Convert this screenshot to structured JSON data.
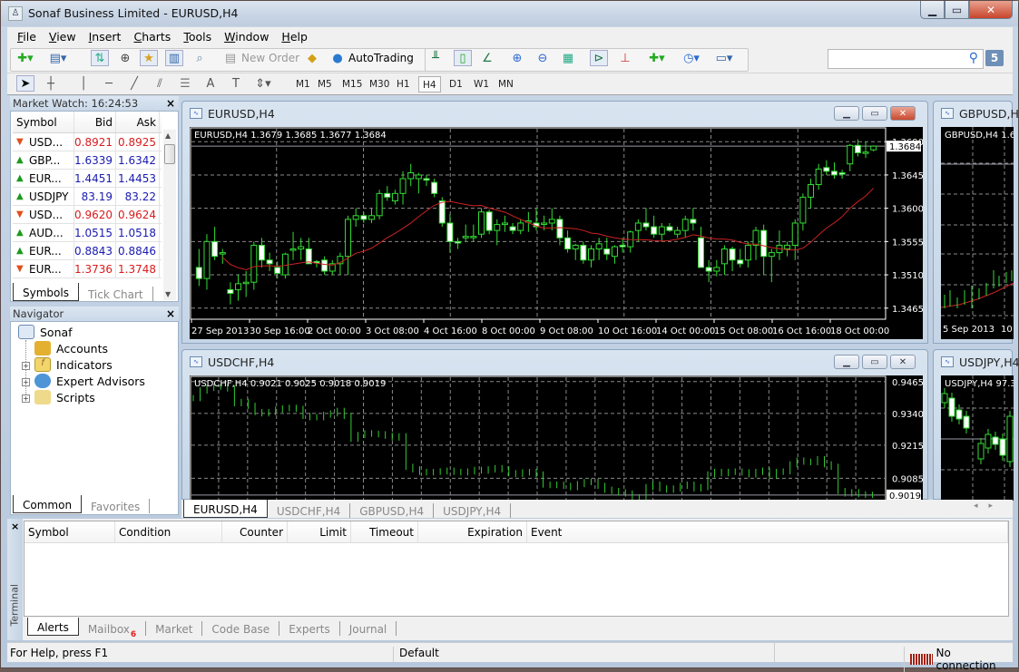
{
  "window": {
    "title": "Sonaf Business Limited - EURUSD,H4"
  },
  "menu": [
    "File",
    "View",
    "Insert",
    "Charts",
    "Tools",
    "Window",
    "Help"
  ],
  "toolbar": {
    "new_order_label": "New Order",
    "autotrading_label": "AutoTrading",
    "search_placeholder": "",
    "notifications_count": "5",
    "timeframes": [
      "M1",
      "M5",
      "M15",
      "M30",
      "H1",
      "H4",
      "D1",
      "W1",
      "MN"
    ],
    "selected_timeframe": "H4"
  },
  "market_watch": {
    "title": "Market Watch: 16:24:53",
    "columns": [
      "Symbol",
      "Bid",
      "Ask"
    ],
    "rows": [
      {
        "symbol": "USD...",
        "bid": "0.8921",
        "ask": "0.8925",
        "dir": "down"
      },
      {
        "symbol": "GBP...",
        "bid": "1.6339",
        "ask": "1.6342",
        "dir": "up"
      },
      {
        "symbol": "EUR...",
        "bid": "1.4451",
        "ask": "1.4453",
        "dir": "up"
      },
      {
        "symbol": "USDJPY",
        "bid": "83.19",
        "ask": "83.22",
        "dir": "up"
      },
      {
        "symbol": "USD...",
        "bid": "0.9620",
        "ask": "0.9624",
        "dir": "down"
      },
      {
        "symbol": "AUD...",
        "bid": "1.0515",
        "ask": "1.0518",
        "dir": "up"
      },
      {
        "symbol": "EUR...",
        "bid": "0.8843",
        "ask": "0.8846",
        "dir": "up"
      },
      {
        "symbol": "EUR...",
        "bid": "1.3736",
        "ask": "1.3748",
        "dir": "down"
      }
    ],
    "tabs": [
      "Symbols",
      "Tick Chart"
    ],
    "active_tab": "Symbols"
  },
  "navigator": {
    "title": "Navigator",
    "root": "Sonaf",
    "items": [
      "Accounts",
      "Indicators",
      "Expert Advisors",
      "Scripts"
    ],
    "tabs": [
      "Common",
      "Favorites"
    ],
    "active_tab": "Common"
  },
  "charts": {
    "eurusd": {
      "window_title": "EURUSD,H4",
      "info": "EURUSD,H4  1.3679 1.3685 1.3677 1.3684",
      "price_labels": [
        "1.3690",
        "1.3645",
        "1.3600",
        "1.3555",
        "1.3510",
        "1.3465"
      ],
      "current_price": "1.3684",
      "time_labels": [
        "27 Sep 2013",
        "30 Sep 16:00",
        "2 Oct 00:00",
        "3 Oct 08:00",
        "4 Oct 16:00",
        "8 Oct 00:00",
        "9 Oct 08:00",
        "10 Oct 16:00",
        "14 Oct 00:00",
        "15 Oct 08:00",
        "16 Oct 16:00",
        "18 Oct 00:00"
      ]
    },
    "gbpusd": {
      "window_title": "GBPUSD,H4",
      "info": "GBPUSD,H4  1.6",
      "time_labels": [
        "5 Sep 2013",
        "10"
      ]
    },
    "usdchf": {
      "window_title": "USDCHF,H4",
      "info": "USDCHF,H4  0.9021 0.9025 0.9018 0.9019",
      "price_labels": [
        "0.9465",
        "0.9340",
        "0.9215",
        "0.9085"
      ],
      "current_price": "0.9019"
    },
    "usdjpy": {
      "window_title": "USDJPY,H4",
      "info": "USDJPY,H4  97.3"
    }
  },
  "chart_tabs": [
    "EURUSD,H4",
    "USDCHF,H4",
    "GBPUSD,H4",
    "USDJPY,H4"
  ],
  "active_chart_tab": "EURUSD,H4",
  "terminal": {
    "side_label": "Terminal",
    "columns": [
      "Symbol",
      "Condition",
      "Counter",
      "Limit",
      "Timeout",
      "Expiration",
      "Event"
    ],
    "tabs": [
      "Alerts",
      "Mailbox",
      "Market",
      "Code Base",
      "Experts",
      "Journal"
    ],
    "mailbox_badge": "6",
    "active_tab": "Alerts"
  },
  "status": {
    "help": "For Help, press F1",
    "profile": "Default",
    "connection": "No connection"
  },
  "colors": {
    "bull": "#33dd33",
    "ma": "#cc2222",
    "grid": "#8a8a8a",
    "bid_up": "#1a1ab0",
    "bid_down": "#d81c1c"
  },
  "chart_data": [
    {
      "type": "candlestick",
      "title": "EURUSD,H4",
      "ylim": [
        1.345,
        1.3705
      ],
      "yticks": [
        1.3465,
        1.351,
        1.3555,
        1.36,
        1.3645,
        1.369
      ],
      "ohlc": [
        [
          1.352,
          1.3545,
          1.3495,
          1.3505
        ],
        [
          1.3505,
          1.3565,
          1.349,
          1.3555
        ],
        [
          1.3555,
          1.3575,
          1.353,
          1.3535
        ],
        [
          1.354,
          1.3545,
          1.3525,
          1.354
        ],
        [
          1.349,
          1.35,
          1.347,
          1.3485
        ],
        [
          1.349,
          1.351,
          1.3475,
          1.3498
        ],
        [
          1.35,
          1.3515,
          1.348,
          1.35
        ],
        [
          1.35,
          1.3555,
          1.349,
          1.355
        ],
        [
          1.355,
          1.356,
          1.352,
          1.353
        ],
        [
          1.353,
          1.354,
          1.3515,
          1.3525
        ],
        [
          1.352,
          1.3528,
          1.3505,
          1.3512
        ],
        [
          1.351,
          1.354,
          1.3505,
          1.3538
        ],
        [
          1.3545,
          1.3568,
          1.353,
          1.3545
        ],
        [
          1.3545,
          1.356,
          1.353,
          1.3548
        ],
        [
          1.3545,
          1.356,
          1.3525,
          1.3525
        ],
        [
          1.3528,
          1.353,
          1.352,
          1.3527
        ],
        [
          1.353,
          1.3535,
          1.351,
          1.3515
        ],
        [
          1.3515,
          1.353,
          1.351,
          1.3525
        ],
        [
          1.3525,
          1.354,
          1.351,
          1.3535
        ],
        [
          1.3535,
          1.359,
          1.351,
          1.3585
        ],
        [
          1.3585,
          1.36,
          1.3575,
          1.359
        ],
        [
          1.359,
          1.3595,
          1.358,
          1.3585
        ],
        [
          1.3585,
          1.36,
          1.358,
          1.359
        ],
        [
          1.359,
          1.3625,
          1.3585,
          1.362
        ],
        [
          1.362,
          1.363,
          1.361,
          1.3615
        ],
        [
          1.361,
          1.3625,
          1.3605,
          1.362
        ],
        [
          1.362,
          1.365,
          1.3605,
          1.364
        ],
        [
          1.364,
          1.366,
          1.363,
          1.3648
        ],
        [
          1.364,
          1.3648,
          1.362,
          1.3645
        ],
        [
          1.364,
          1.3645,
          1.363,
          1.3638
        ],
        [
          1.3635,
          1.364,
          1.3615,
          1.362
        ],
        [
          1.361,
          1.3615,
          1.3575,
          1.358
        ],
        [
          1.358,
          1.3592,
          1.354,
          1.3555
        ],
        [
          1.3555,
          1.356,
          1.3545,
          1.3553
        ],
        [
          1.356,
          1.3578,
          1.3555,
          1.3562
        ],
        [
          1.3562,
          1.3578,
          1.3555,
          1.3562
        ],
        [
          1.3565,
          1.36,
          1.356,
          1.3595
        ],
        [
          1.3595,
          1.3598,
          1.3565,
          1.357
        ],
        [
          1.357,
          1.3585,
          1.355,
          1.3578
        ],
        [
          1.3578,
          1.359,
          1.3568,
          1.358
        ],
        [
          1.3575,
          1.358,
          1.3565,
          1.357
        ],
        [
          1.357,
          1.3585,
          1.3565,
          1.358
        ],
        [
          1.3582,
          1.3595,
          1.3568,
          1.3583
        ],
        [
          1.358,
          1.36,
          1.357,
          1.3575
        ],
        [
          1.358,
          1.359,
          1.357,
          1.358
        ],
        [
          1.358,
          1.36,
          1.357,
          1.3585
        ],
        [
          1.3585,
          1.359,
          1.355,
          1.356
        ],
        [
          1.356,
          1.357,
          1.354,
          1.3545
        ],
        [
          1.3545,
          1.3552,
          1.353,
          1.355
        ],
        [
          1.355,
          1.3555,
          1.3525,
          1.353
        ],
        [
          1.353,
          1.355,
          1.352,
          1.3545
        ],
        [
          1.3545,
          1.356,
          1.353,
          1.3552
        ],
        [
          1.3545,
          1.356,
          1.353,
          1.3538
        ],
        [
          1.3535,
          1.355,
          1.3525,
          1.3548
        ],
        [
          1.355,
          1.356,
          1.354,
          1.3548
        ],
        [
          1.3548,
          1.357,
          1.354,
          1.3568
        ],
        [
          1.357,
          1.3585,
          1.3555,
          1.358
        ],
        [
          1.358,
          1.36,
          1.357,
          1.3575
        ],
        [
          1.3575,
          1.359,
          1.356,
          1.3565
        ],
        [
          1.3565,
          1.358,
          1.3555,
          1.3575
        ],
        [
          1.3575,
          1.358,
          1.3568,
          1.357
        ],
        [
          1.3565,
          1.3575,
          1.356,
          1.357
        ],
        [
          1.357,
          1.359,
          1.356,
          1.3585
        ],
        [
          1.3585,
          1.36,
          1.357,
          1.358
        ],
        [
          1.356,
          1.3575,
          1.352,
          1.352
        ],
        [
          1.352,
          1.353,
          1.35,
          1.3515
        ],
        [
          1.3515,
          1.353,
          1.3508,
          1.352
        ],
        [
          1.3525,
          1.355,
          1.351,
          1.3545
        ],
        [
          1.3545,
          1.3548,
          1.3515,
          1.353
        ],
        [
          1.353,
          1.3545,
          1.352,
          1.3525
        ],
        [
          1.353,
          1.3555,
          1.352,
          1.355
        ],
        [
          1.355,
          1.3575,
          1.353,
          1.357
        ],
        [
          1.357,
          1.3578,
          1.351,
          1.3535
        ],
        [
          1.3535,
          1.3545,
          1.35,
          1.354
        ],
        [
          1.354,
          1.357,
          1.353,
          1.355
        ],
        [
          1.3545,
          1.3555,
          1.3535,
          1.355
        ],
        [
          1.355,
          1.3585,
          1.353,
          1.358
        ],
        [
          1.358,
          1.362,
          1.357,
          1.3615
        ],
        [
          1.3615,
          1.364,
          1.36,
          1.3632
        ],
        [
          1.3632,
          1.366,
          1.3625,
          1.3653
        ],
        [
          1.3655,
          1.3665,
          1.3645,
          1.365
        ],
        [
          1.365,
          1.3662,
          1.364,
          1.3645
        ],
        [
          1.3648,
          1.3652,
          1.364,
          1.3646
        ],
        [
          1.366,
          1.3687,
          1.365,
          1.3685
        ],
        [
          1.3685,
          1.3693,
          1.367,
          1.3675
        ],
        [
          1.3675,
          1.369,
          1.3668,
          1.3676
        ],
        [
          1.3679,
          1.3685,
          1.3677,
          1.3684
        ]
      ],
      "ma": {
        "color": "#cc2222",
        "start": 1.3515,
        "end": 1.363
      }
    },
    {
      "type": "bars",
      "title": "USDCHF,H4",
      "ylim": [
        0.899,
        0.9475
      ],
      "yticks": [
        0.9085,
        0.9215,
        0.934,
        0.9465
      ],
      "close_series": [
        0.94,
        0.943,
        0.944,
        0.9445,
        0.9445,
        0.9438,
        0.938,
        0.9385,
        0.937,
        0.9345,
        0.934,
        0.9345,
        0.9355,
        0.936,
        0.9362,
        0.9358,
        0.933,
        0.9325,
        0.9325,
        0.9335,
        0.934,
        0.935,
        0.933,
        0.924,
        0.9255,
        0.9262,
        0.926,
        0.9258,
        0.9252,
        0.9245,
        0.925,
        0.913,
        0.912,
        0.911,
        0.9108,
        0.911,
        0.9112,
        0.9115,
        0.911,
        0.9108,
        0.9112,
        0.9118,
        0.9115,
        0.912,
        0.9125,
        0.912,
        0.9105,
        0.9102,
        0.9108,
        0.911,
        0.91,
        0.906,
        0.9058,
        0.906,
        0.9055,
        0.905,
        0.9062,
        0.907,
        0.9072,
        0.9055,
        0.904,
        0.9035,
        0.903,
        0.9025,
        0.901,
        0.9,
        0.905,
        0.906,
        0.9045,
        0.904,
        0.9045,
        0.9055,
        0.906,
        0.9045,
        0.905,
        0.91,
        0.911,
        0.9105,
        0.911,
        0.9112,
        0.9108,
        0.91,
        0.911,
        0.9115,
        0.9095,
        0.911,
        0.9112,
        0.914,
        0.9155,
        0.915,
        0.9148,
        0.916,
        0.914,
        0.913,
        0.9035,
        0.9025,
        0.903,
        0.9022,
        0.902,
        0.9019
      ]
    }
  ]
}
